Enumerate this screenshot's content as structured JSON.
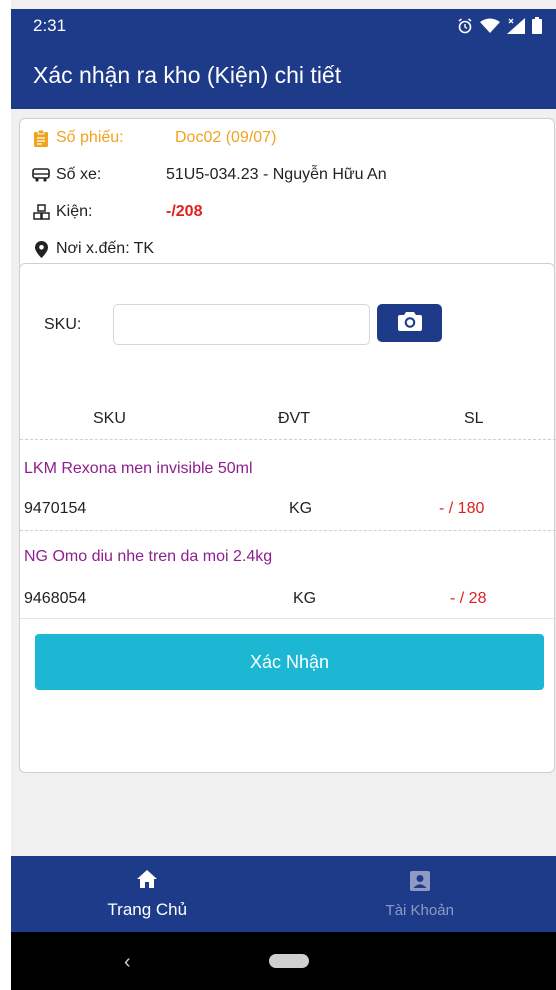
{
  "status_bar": {
    "time": "2:31",
    "icons": [
      "alarm-icon",
      "wifi-icon",
      "signal-icon",
      "battery-icon"
    ]
  },
  "app_bar": {
    "title": "Xác nhận ra kho (Kiện) chi tiết"
  },
  "info": {
    "doc_label": "Số phiếu:",
    "doc_value": "Doc02 (09/07)",
    "truck_label": "Số xe:",
    "truck_value": "51U5-034.23 - Nguyễn Hữu An",
    "package_label": "Kiện:",
    "package_value": "-/208",
    "destination_label": "Nơi x.đến:",
    "destination_value": "TK"
  },
  "scan": {
    "sku_label": "SKU:",
    "sku_value": "",
    "sku_placeholder": "",
    "camera_icon": "camera-icon"
  },
  "table": {
    "headers": [
      "SKU",
      "ĐVT",
      "SL"
    ],
    "rows": [
      {
        "name": "LKM Rexona men invisible 50ml",
        "code": "9470154",
        "unit": "KG",
        "qty": "- / 180"
      },
      {
        "name": "NG Omo diu nhe tren da moi 2.4kg",
        "code": "9468054",
        "unit": "KG",
        "qty": "- / 28"
      }
    ]
  },
  "actions": {
    "confirm_label": "Xác Nhận"
  },
  "bottom_nav": {
    "items": [
      {
        "label": "Trang Chủ",
        "icon": "home-icon",
        "active": true
      },
      {
        "label": "Tài Khoản",
        "icon": "account-icon",
        "active": false
      }
    ]
  },
  "colors": {
    "primary": "#1e3b8a",
    "accent": "#1cb8d3",
    "doc_orange": "#f0a31f",
    "qty_red": "#e02020",
    "item_purple": "#8e1e8e"
  }
}
